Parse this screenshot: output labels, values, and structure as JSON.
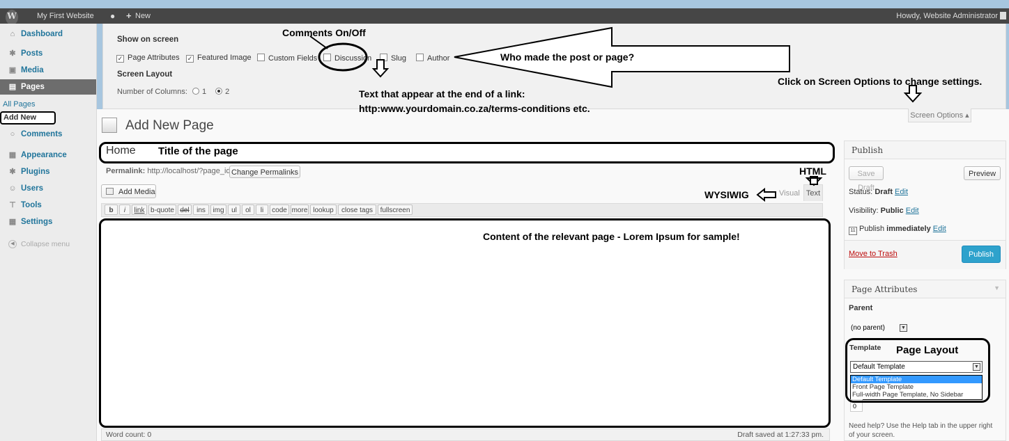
{
  "admin_bar": {
    "site_name": "My First Website",
    "new_label": "New",
    "howdy": "Howdy, Website Administrator"
  },
  "sidebar": {
    "items": [
      {
        "label": "Dashboard",
        "icon": "dashboard-icon"
      },
      {
        "label": "Posts",
        "icon": "pin-icon"
      },
      {
        "label": "Media",
        "icon": "media-icon"
      },
      {
        "label": "Pages",
        "icon": "pages-icon",
        "active": true
      },
      {
        "label": "Comments",
        "icon": "comment-icon"
      },
      {
        "label": "Appearance",
        "icon": "appearance-icon"
      },
      {
        "label": "Plugins",
        "icon": "plugin-icon"
      },
      {
        "label": "Users",
        "icon": "users-icon"
      },
      {
        "label": "Tools",
        "icon": "tools-icon"
      },
      {
        "label": "Settings",
        "icon": "settings-icon"
      }
    ],
    "submenu": {
      "all_pages": "All Pages",
      "add_new": "Add New"
    },
    "collapse": "Collapse menu"
  },
  "screen_options": {
    "show_on_screen": "Show on screen",
    "checkboxes": [
      {
        "label": "Page Attributes",
        "checked": true
      },
      {
        "label": "Featured Image",
        "checked": true
      },
      {
        "label": "Custom Fields",
        "checked": false
      },
      {
        "label": "Discussion",
        "checked": false
      },
      {
        "label": "Slug",
        "checked": false
      },
      {
        "label": "Author",
        "checked": false
      }
    ],
    "screen_layout": "Screen Layout",
    "columns_label": "Number of Columns:",
    "col1": "1",
    "col2": "2",
    "tab_label": "Screen Options ▴"
  },
  "page": {
    "heading": "Add New Page",
    "title_value": "Home",
    "permalink_label": "Permalink:",
    "permalink_url": "http://localhost/?page_id=4",
    "change_permalinks": "Change Permalinks",
    "add_media": "Add Media",
    "tab_visual": "Visual",
    "tab_text": "Text",
    "quicktags": [
      "b",
      "i",
      "link",
      "b-quote",
      "del",
      "ins",
      "img",
      "ul",
      "ol",
      "li",
      "code",
      "more",
      "lookup",
      "close tags",
      "fullscreen"
    ],
    "word_count": "Word count: 0",
    "draft_saved": "Draft saved at 1:27:33 pm."
  },
  "publish_box": {
    "title": "Publish",
    "save_draft": "Save Draft",
    "preview": "Preview",
    "status_label": "Status:",
    "status_value": "Draft",
    "visibility_label": "Visibility:",
    "visibility_value": "Public",
    "publish_label": "Publish",
    "publish_value": "immediately",
    "edit": "Edit",
    "move_to_trash": "Move to Trash",
    "publish_button": "Publish"
  },
  "attributes_box": {
    "title": "Page Attributes",
    "parent_label": "Parent",
    "parent_value": "(no parent)",
    "template_label": "Template",
    "template_value": "Default Template",
    "template_options": [
      "Default Template",
      "Front Page Template",
      "Full-width Page Template, No Sidebar"
    ],
    "order_value": "0",
    "help_line1": "Need help? Use the Help tab in the upper right",
    "help_line2": "of your screen."
  },
  "annotations": {
    "comments": "Comments On/Off",
    "who_made": "Who made the post or page?",
    "slug_line1": "Text that appear at the end of a link:",
    "slug_line2": "http:www.yourdomain.co.za/terms-conditions etc.",
    "screen_options": "Click on Screen Options to change settings.",
    "title_of_page": "Title of the page",
    "html": "HTML",
    "wysiwyg": "WYSIWIG",
    "content": "Content of the relevant page - Lorem Ipsum for sample!",
    "page_layout": "Page Layout"
  }
}
